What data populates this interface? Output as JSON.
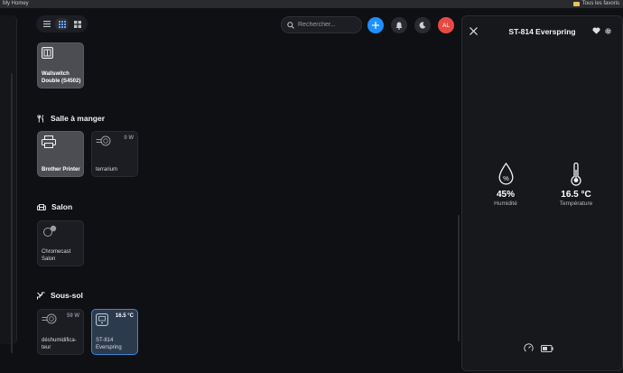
{
  "browser": {
    "tab_title": "My Homey",
    "bookmarks_label": "Tous les favoris"
  },
  "toolbar": {
    "view_modes": [
      "list",
      "grid",
      "large-grid"
    ],
    "active_view": "grid"
  },
  "search": {
    "placeholder": "Rechercher..."
  },
  "header": {
    "avatar_initials": "AL"
  },
  "zones": [
    {
      "name": "",
      "devices": [
        {
          "label": "Wallswitch Double (S4502)",
          "value": "",
          "on": true,
          "icon": "wallswitch-icon"
        }
      ]
    },
    {
      "name": "Salle à manger",
      "icon": "fork-knife-icon",
      "devices": [
        {
          "label": "Brother Printer",
          "value": "",
          "on": true,
          "icon": "printer-icon"
        },
        {
          "label": "terrarium",
          "value": "0 W",
          "on": false,
          "icon": "plug-icon"
        }
      ]
    },
    {
      "name": "Salon",
      "icon": "sofa-icon",
      "devices": [
        {
          "label": "Chromecast Salon",
          "value": "",
          "on": false,
          "icon": "chromecast-icon"
        }
      ]
    },
    {
      "name": "Sous-sol",
      "icon": "stairs-icon",
      "devices": [
        {
          "label": "déshumidifica-teur",
          "value": "59 W",
          "on": false,
          "icon": "plug-icon"
        },
        {
          "label": "ST-814 Everspring",
          "value": "16.5 °C",
          "on": false,
          "selected": true,
          "icon": "sensor-icon"
        }
      ]
    }
  ],
  "detail": {
    "title": "ST-814 Everspring",
    "humidity": {
      "value": "45%",
      "label": "Humidité"
    },
    "temperature": {
      "value": "16.5 °C",
      "label": "Température"
    }
  },
  "colors": {
    "accent": "#1e90ff",
    "avatar": "#e84a43",
    "selected_border": "#3a87d9"
  }
}
